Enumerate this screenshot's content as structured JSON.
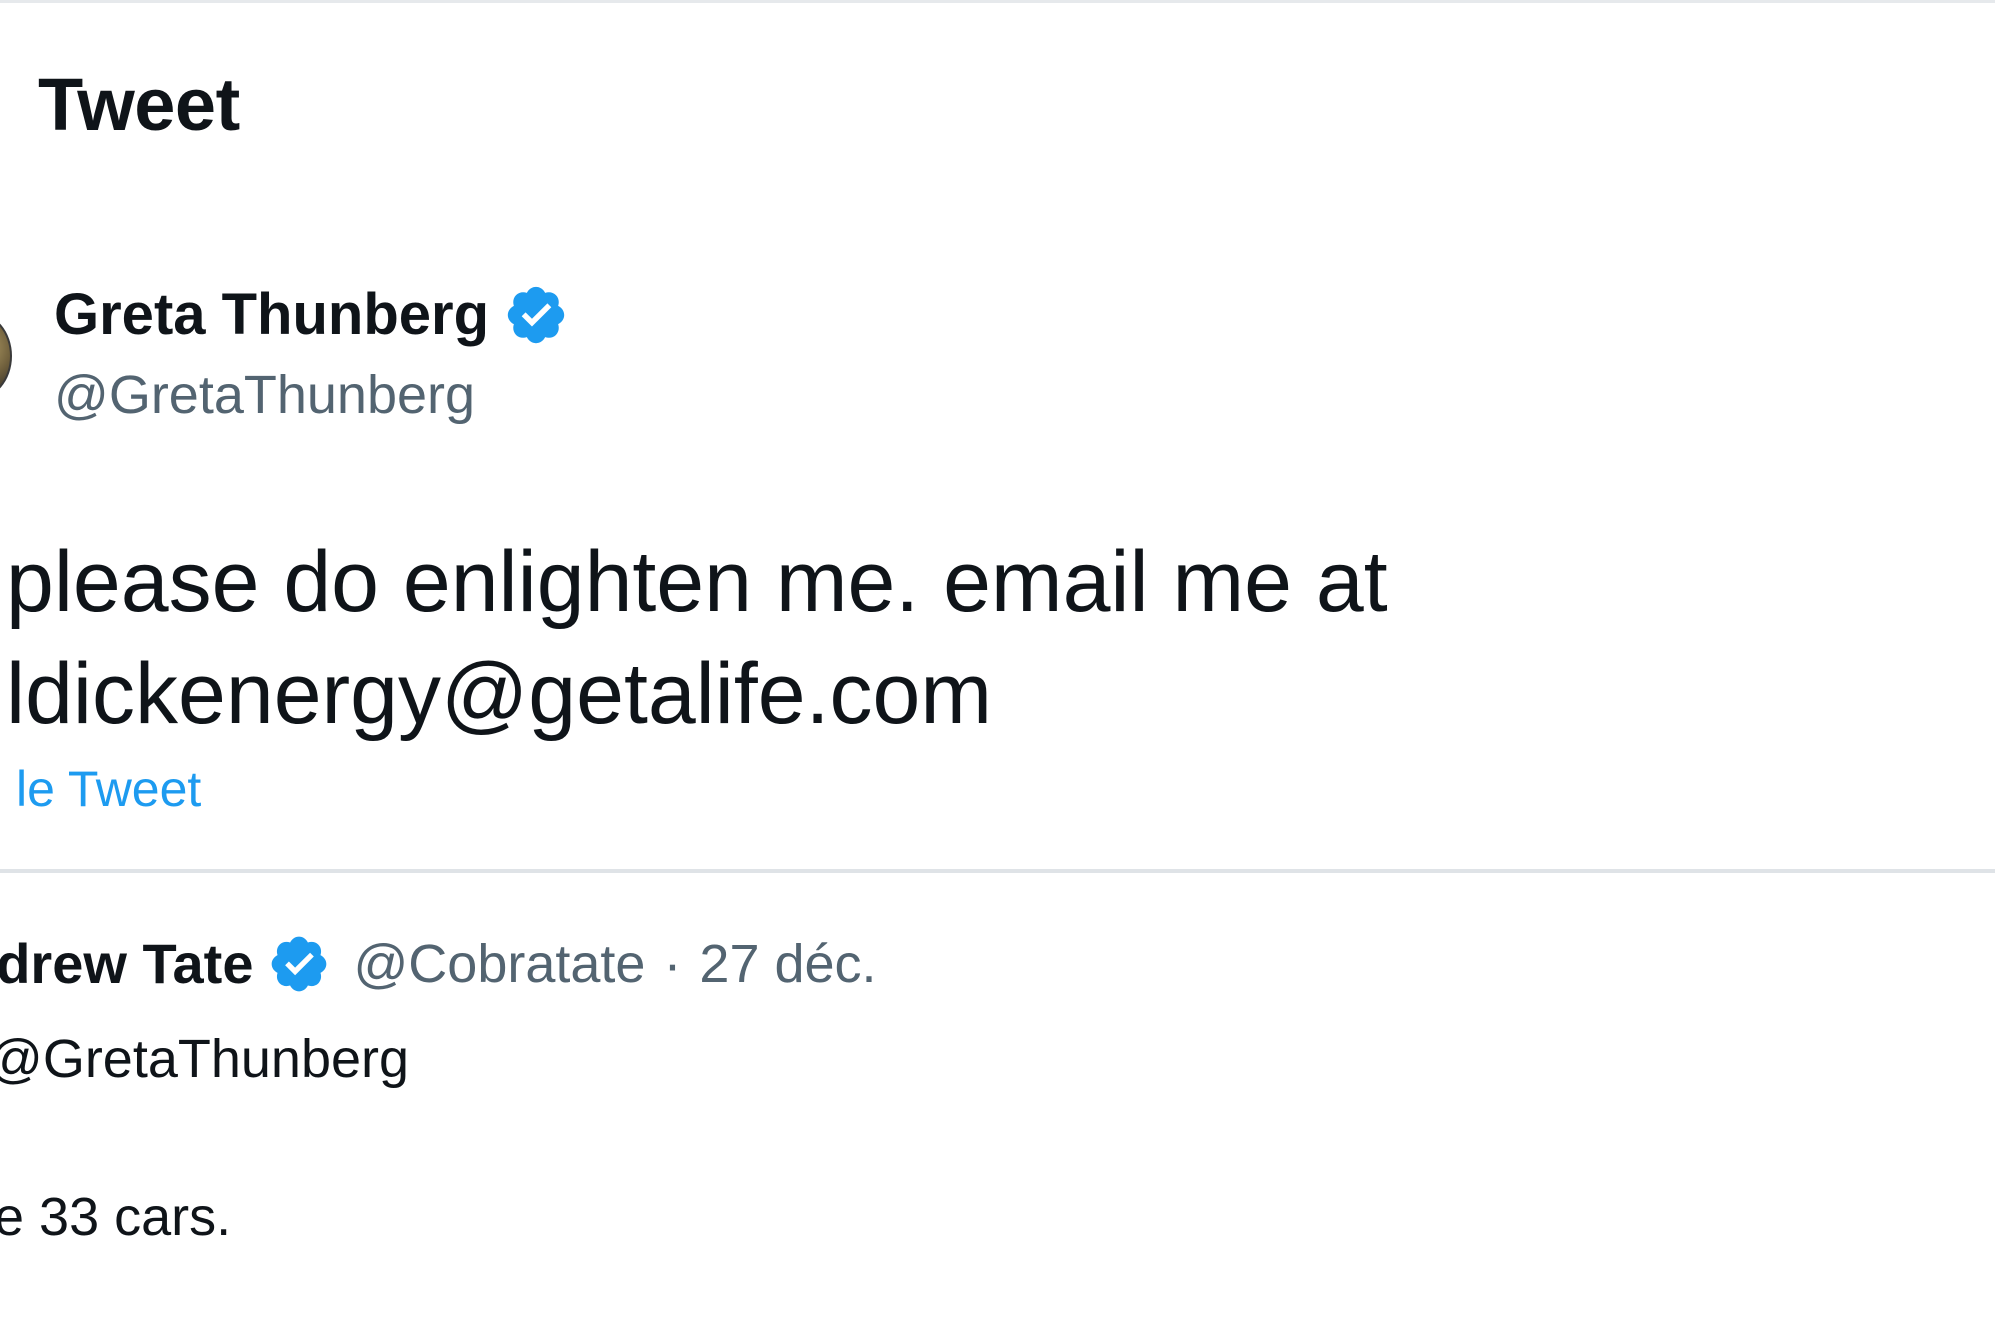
{
  "header": {
    "title": "Tweet"
  },
  "tweet": {
    "author_name": "Greta Thunberg",
    "author_handle": "@GretaThunberg",
    "verified_icon": "verified-badge-icon",
    "text_lines": [
      "please do enlighten me. email me at",
      "ldickenergy@getalife.com"
    ],
    "translate_link": "le Tweet"
  },
  "reply": {
    "author_name": "ndrew Tate",
    "handle": "@Cobratate",
    "separator": "·",
    "date": "27 déc.",
    "line1": "@GretaThunberg",
    "line2": "e 33 cars."
  },
  "colors": {
    "text_primary": "#0f1419",
    "text_secondary": "#536471",
    "accent_blue": "#1d9bf0",
    "divider": "#dfe3e7"
  }
}
